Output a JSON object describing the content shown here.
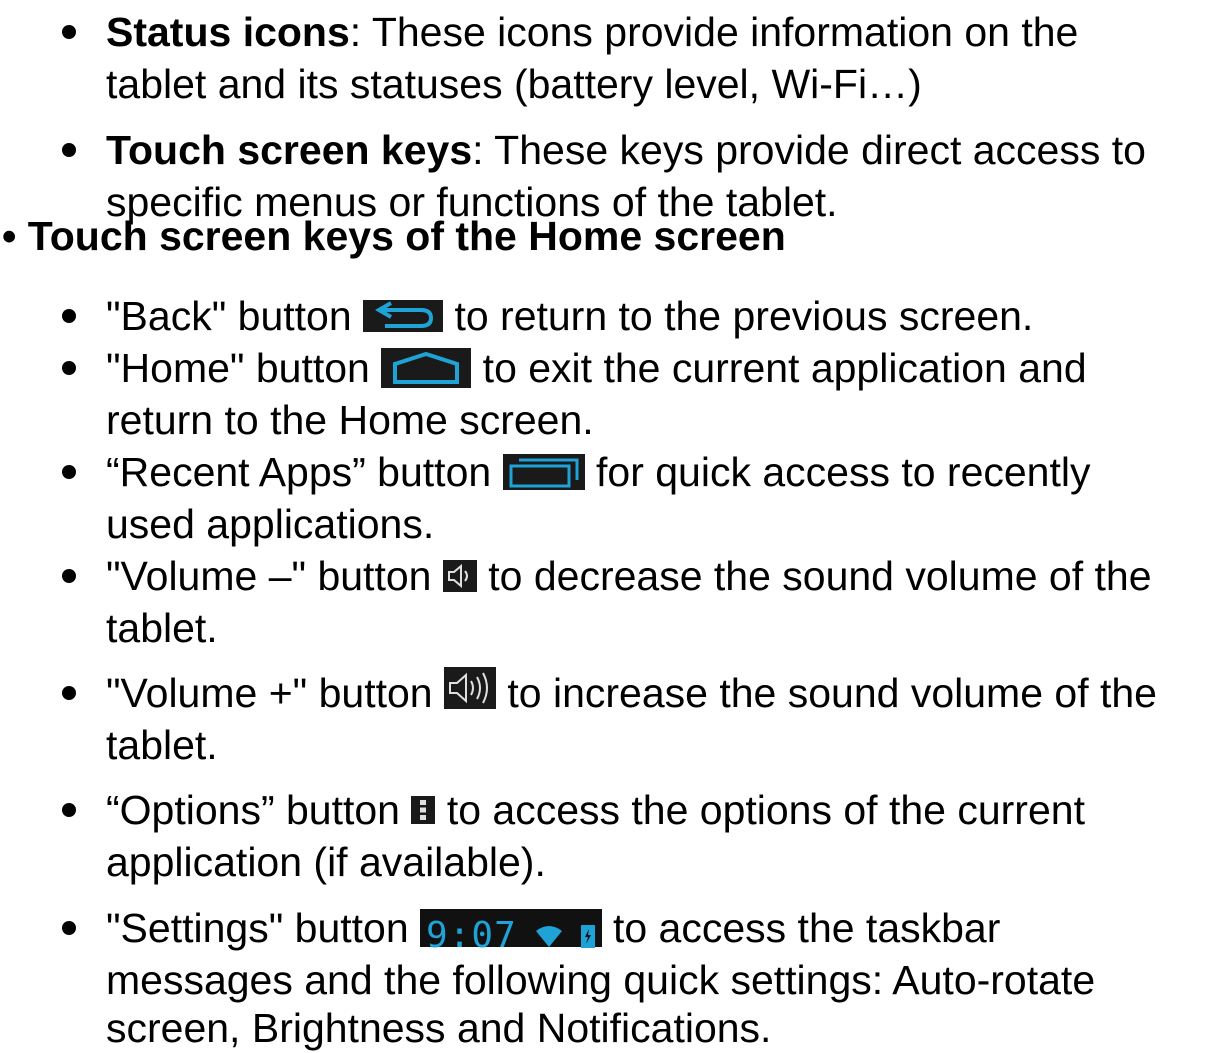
{
  "status_icons": {
    "term": "Status icons",
    "line1_rest": ": These icons provide information on the",
    "line2": "tablet and its statuses (battery level, Wi-Fi…)"
  },
  "touch_keys": {
    "term": "Touch screen keys",
    "line1_rest": ": These keys provide direct access to",
    "line2": "specific menus or functions of the tablet."
  },
  "section": {
    "heading": "• Touch screen keys of the Home screen"
  },
  "items": {
    "back": {
      "pre": "\"Back\" button",
      "post": "to return to the previous screen.",
      "icon": "back-arrow-icon"
    },
    "home": {
      "pre": "\"Home\" button",
      "post": "to exit the current application and",
      "line2": "return to the Home screen.",
      "icon": "home-icon"
    },
    "recent": {
      "pre": "“Recent Apps” button",
      "post": "for quick access to recently",
      "line2": "used applications.",
      "icon": "recent-apps-icon"
    },
    "vol_down": {
      "pre": "\"Volume –\" button",
      "post": "to decrease the sound volume of the",
      "line2": "tablet.",
      "icon": "volume-down-icon"
    },
    "vol_up": {
      "pre": "\"Volume +\" button",
      "post": "to increase the sound volume of the",
      "line2": "tablet.",
      "icon": "volume-up-icon"
    },
    "options": {
      "pre": "“Options” button",
      "post": "to access the options of the current",
      "line2": "application (if available).",
      "icon": "options-icon"
    },
    "settings": {
      "pre": "\"Settings\" button",
      "clock": "9:07",
      "post": "to access the taskbar",
      "line2": "messages and the following quick settings: Auto-rotate",
      "line3": "screen, Brightness and Notifications.",
      "icon": "settings-status-icon"
    }
  },
  "colors": {
    "icon_accent": "#1fa3d6",
    "icon_bg": "#1a1a1a",
    "text": "#000000"
  }
}
